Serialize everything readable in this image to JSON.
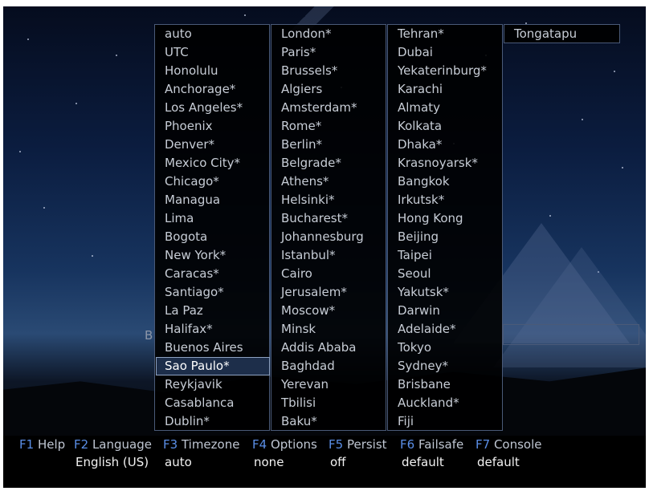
{
  "colors": {
    "accent": "#5a8ee6",
    "selection": "#1d2e4a",
    "border": "#4a5a78"
  },
  "timezones": {
    "col1": [
      "auto",
      "UTC",
      "Honolulu",
      "Anchorage*",
      "Los Angeles*",
      "Phoenix",
      "Denver*",
      "Mexico City*",
      "Chicago*",
      "Managua",
      "Lima",
      "Bogota",
      "New York*",
      "Caracas*",
      "Santiago*",
      "La Paz",
      "Halifax*",
      "Buenos Aires",
      "Sao Paulo*",
      "Reykjavik",
      "Casablanca",
      "Dublin*"
    ],
    "col2": [
      "London*",
      "Paris*",
      "Brussels*",
      "Algiers",
      "Amsterdam*",
      "Rome*",
      "Berlin*",
      "Belgrade*",
      "Athens*",
      "Helsinki*",
      "Bucharest*",
      "Johannesburg",
      "Istanbul*",
      "Cairo",
      "Jerusalem*",
      "Moscow*",
      "Minsk",
      "Addis Ababa",
      "Baghdad",
      "Yerevan",
      "Tbilisi",
      "Baku*"
    ],
    "col3": [
      "Tehran*",
      "Dubai",
      "Yekaterinburg*",
      "Karachi",
      "Almaty",
      "Kolkata",
      "Dhaka*",
      "Krasnoyarsk*",
      "Bangkok",
      "Irkutsk*",
      "Hong Kong",
      "Beijing",
      "Taipei",
      "Seoul",
      "Yakutsk*",
      "Darwin",
      "Adelaide*",
      "Tokyo",
      "Sydney*",
      "Brisbane",
      "Auckland*",
      "Fiji"
    ],
    "col4": [
      "Tongatapu"
    ],
    "selected": "Sao Paulo*"
  },
  "background": {
    "stray_letter": "B"
  },
  "footer": {
    "keys": [
      {
        "key": "F1",
        "label": "Help"
      },
      {
        "key": "F2",
        "label": "Language"
      },
      {
        "key": "F3",
        "label": "Timezone"
      },
      {
        "key": "F4",
        "label": "Options"
      },
      {
        "key": "F5",
        "label": "Persist"
      },
      {
        "key": "F6",
        "label": "Failsafe"
      },
      {
        "key": "F7",
        "label": "Console"
      }
    ],
    "values": {
      "language": "English (US)",
      "timezone": "auto",
      "options": "none",
      "persist": "off",
      "failsafe": "default",
      "console": "default"
    }
  }
}
